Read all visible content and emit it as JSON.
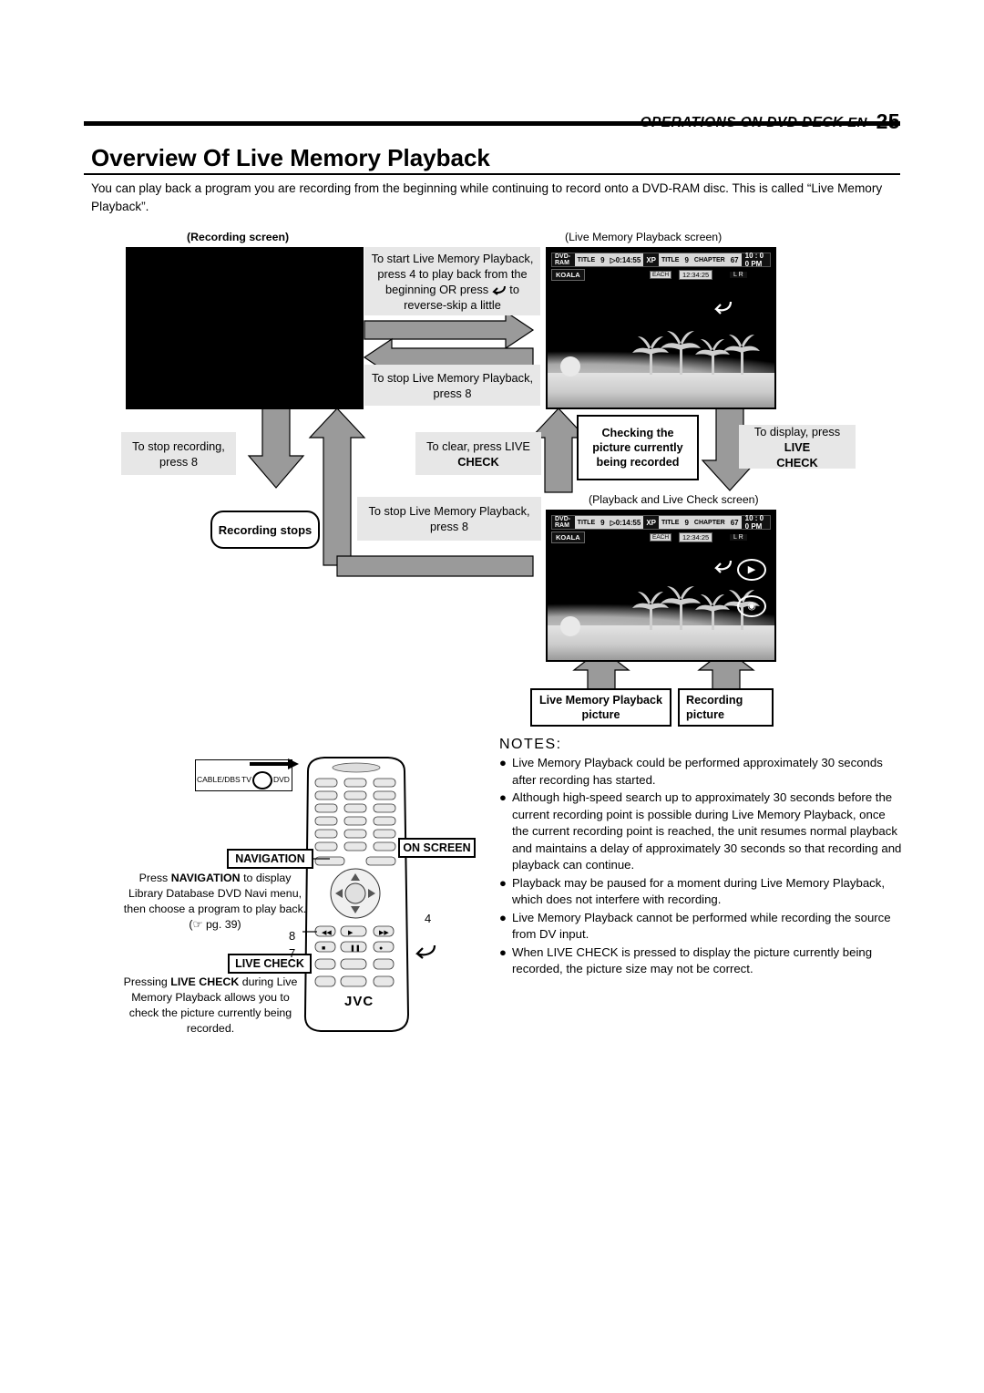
{
  "header": {
    "section": "OPERATIONS ON DVD DECK",
    "en": "EN",
    "page": "25"
  },
  "title": "Overview Of Live Memory Playback",
  "intro": "You can play back a program you are recording from the beginning while continuing to record onto a DVD-RAM disc. This is called “Live Memory Playback”.",
  "diagram": {
    "recording_screen_label": "(Recording screen)",
    "live_memory_screen_label": "(Live Memory Playback screen)",
    "playback_livecheck_screen_label": "(Playback and Live Check screen)",
    "start_instruction": "To start Live Memory Playback, press 4  to play back from the beginning OR press       to reverse-skip a little",
    "start_line1": "To start Live Memory Playback,",
    "start_line2": "press 4  to play back from the",
    "start_line3": "beginning OR press",
    "start_line3b": "to",
    "start_line4": "reverse-skip a little",
    "stop_lmp_1": "To stop Live Memory Playback,",
    "stop_lmp_1b": "press 8",
    "stop_recording": "To stop recording,",
    "stop_recording_b": "press 8",
    "recording_stops": "Recording stops",
    "to_clear": "To clear, press LIVE",
    "to_clear_b": "CHECK",
    "stop_lmp_2": "To stop Live Memory Playback,",
    "stop_lmp_2b": "press 8",
    "checking_box_l1": "Checking the",
    "checking_box_l2": "picture currently",
    "checking_box_l3": "being recorded",
    "to_display": "To display, press LIVE",
    "to_display_b": "CHECK",
    "lmp_picture_l1": "Live Memory Playback",
    "lmp_picture_l2": "picture",
    "rec_picture_l1": "Recording",
    "rec_picture_l2": "picture"
  },
  "osd": {
    "disc": "DVD-RAM",
    "title_label": "TITLE",
    "title_num": "9",
    "elapsed": "0:14:55",
    "mode": "XP",
    "title2_label": "TITLE",
    "title2_num": "9",
    "chapter_label": "CHAPTER",
    "chapter_num": "67",
    "each": "EACH",
    "remain": "12:34:25",
    "lr": "L    R",
    "clock": "10 : 0 0  PM",
    "program": "KOALA"
  },
  "notes": {
    "heading": "NOTES:",
    "items": [
      "Live Memory Playback could be performed approximately 30 seconds after recording has started.",
      "Although high-speed search up to approximately 30 seconds before the current recording point is possible during Live Memory Playback, once the current recording point is reached, the unit resumes normal playback and maintains a delay of approximately 30 seconds so that recording and playback can continue.",
      "Playback may be paused for a moment during Live Memory Playback, which does not interfere with recording.",
      "Live Memory Playback cannot be performed while recording the source from DV input.",
      "When LIVE CHECK is pressed to display the picture currently being recorded, the picture size may not be correct."
    ]
  },
  "remote": {
    "cable_dbs": "CABLE/DBS",
    "tv": "TV",
    "dvd": "DVD",
    "navigation_label": "NAVIGATION",
    "on_screen_label": "ON SCREEN",
    "live_check_label": "LIVE CHECK",
    "navigation_text_l1": "Press NAVIGATION to display",
    "navigation_text_l2": "Library Database DVD Navi menu,",
    "navigation_text_l3": "then choose a program to play back.",
    "navigation_text_l4": "(☞ pg. 39)",
    "live_check_text_l1": "Pressing LIVE CHECK during Live",
    "live_check_text_l2": "Memory Playback allows you to",
    "live_check_text_l3": "check the picture currently being",
    "live_check_text_l4": "recorded.",
    "num4": "4",
    "num8": "8",
    "num7": "7",
    "brand": "JVC"
  }
}
